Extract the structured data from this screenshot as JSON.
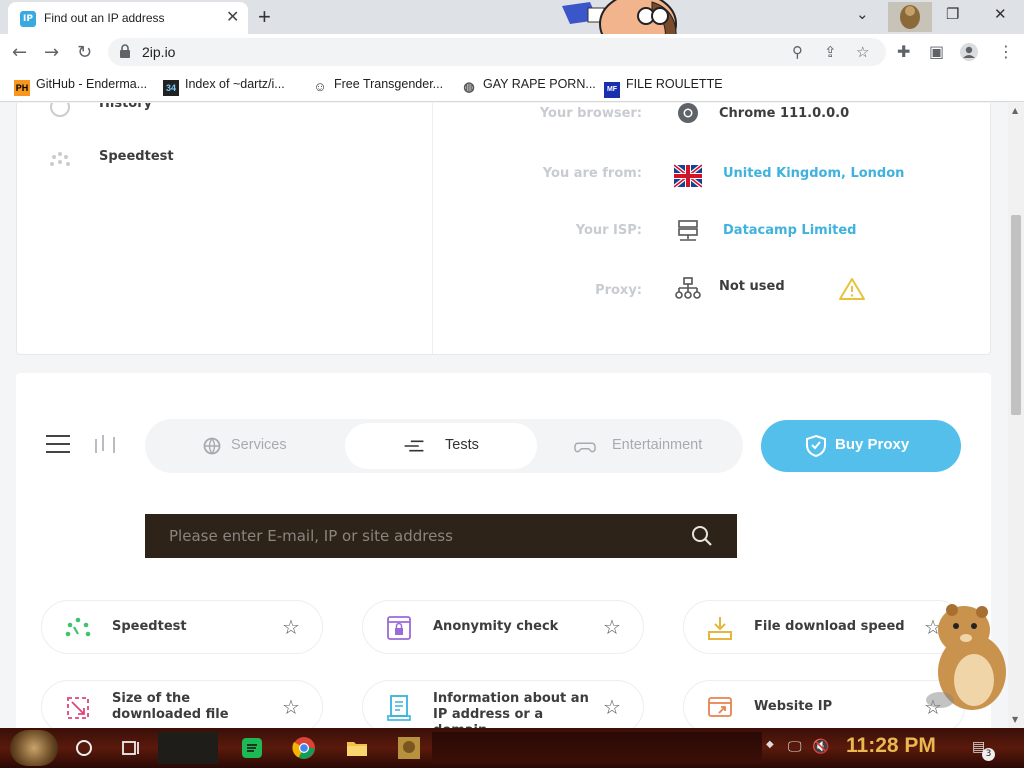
{
  "browser": {
    "tab_title": "Find out an IP address",
    "tab_favicon": "IP",
    "close_tab": "✕",
    "new_tab": "+",
    "url": "2ip.io",
    "bookmarks": [
      {
        "icon": "PH",
        "label": "GitHub - Enderma..."
      },
      {
        "icon": "34",
        "label": "Index of ~dartz/i..."
      },
      {
        "icon": "",
        "label": "Free Transgender..."
      },
      {
        "icon": "",
        "label": "GAY RAPE PORN..."
      },
      {
        "icon": "MF",
        "label": "FILE ROULETTE"
      }
    ]
  },
  "sidebar": {
    "items": [
      {
        "label": "History"
      },
      {
        "label": "Speedtest"
      }
    ]
  },
  "info": {
    "browser_label": "Your browser:",
    "browser_value": "Chrome 111.0.0.0",
    "location_label": "You are from:",
    "location_value": "United Kingdom, London",
    "isp_label": "Your ISP:",
    "isp_value": "Datacamp Limited",
    "proxy_label": "Proxy:",
    "proxy_value": "Not used"
  },
  "nav": {
    "tabs": [
      {
        "label": "Services"
      },
      {
        "label": "Tests"
      },
      {
        "label": "Entertainment"
      }
    ],
    "buy_proxy": "Buy Proxy"
  },
  "search": {
    "placeholder": "Please enter E-mail, IP or site address"
  },
  "tests": [
    {
      "label": "Speedtest"
    },
    {
      "label": "Anonymity check"
    },
    {
      "label": "File download speed"
    },
    {
      "label": "Size of the downloaded file"
    },
    {
      "label": "Information about an IP address or a domain"
    },
    {
      "label": "Website IP"
    }
  ],
  "taskbar": {
    "clock": "11:28 PM",
    "notification_count": "3"
  },
  "colors": {
    "accent": "#54bfeb",
    "link": "#3fb2dd",
    "search_bg": "#2e2318",
    "taskbar": "#4a1409",
    "clock": "#e9b84f"
  }
}
